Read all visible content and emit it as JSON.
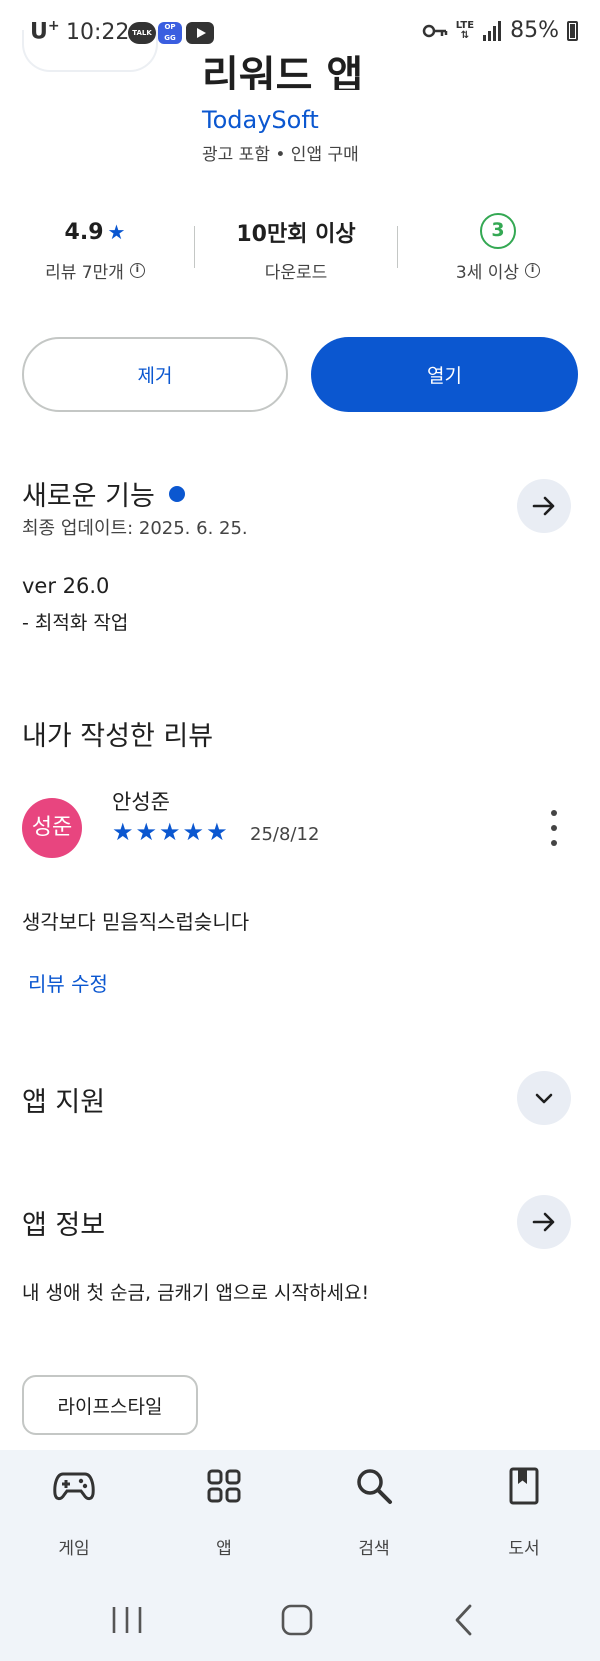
{
  "status_bar": {
    "carrier": "U",
    "carrier_sup": "+",
    "time": "10:22",
    "talk_label": "TALK",
    "opgg_label": "OP GG",
    "lte": "LTE",
    "battery": "85%"
  },
  "app": {
    "title": "리워드 앱",
    "publisher": "TodaySoft",
    "meta": "광고 포함 • 인앱 구매"
  },
  "stats": {
    "rating": "4.9",
    "reviews": "리뷰 7만개",
    "downloads": "10만회 이상",
    "downloads_label": "다운로드",
    "age_rating": "3",
    "age_label": "3세 이상"
  },
  "buttons": {
    "remove": "제거",
    "open": "열기"
  },
  "whats_new": {
    "title": "새로운 기능",
    "updated": "최종 업데이트: 2025. 6. 25.",
    "version": "ver 26.0",
    "note": "- 최적화 작업"
  },
  "my_review": {
    "title": "내가 작성한 리뷰",
    "avatar_text": "성준",
    "author": "안성준",
    "stars": 5,
    "stars_text": "★★★★★",
    "date": "25/8/12",
    "text": "생각보다 믿음직스럽슺니다",
    "edit_label": "리뷰 수정"
  },
  "app_support": {
    "title": "앱 지원"
  },
  "app_info": {
    "title": "앱 정보",
    "description": "내 생애 첫 순금, 금캐기 앱으로 시작하세요!",
    "category": "라이프스타일"
  },
  "bottom_nav": {
    "items": [
      {
        "label": "게임",
        "icon": "gamepad-icon"
      },
      {
        "label": "앱",
        "icon": "apps-grid-icon"
      },
      {
        "label": "검색",
        "icon": "search-icon"
      },
      {
        "label": "도서",
        "icon": "book-icon"
      }
    ]
  },
  "colors": {
    "accent": "#0b57d0",
    "avatar": "#e8457f",
    "age_green": "#34a853",
    "nav_bg": "#f0f4f9"
  }
}
